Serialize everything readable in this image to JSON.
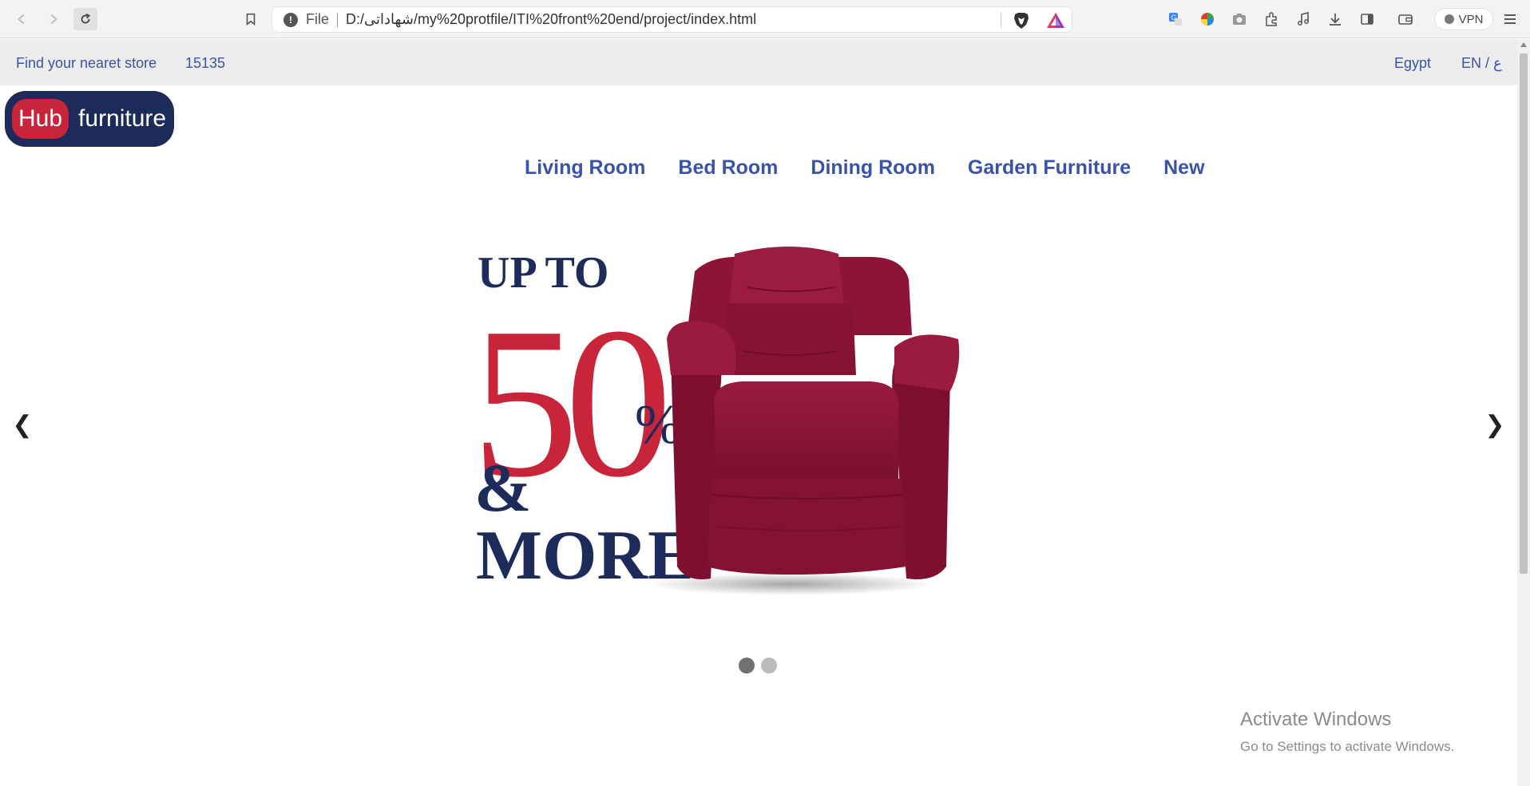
{
  "browser": {
    "address_prefix": "File",
    "url": "D:/شهاداتى/my%20protfile/ITI%20front%20end/project/index.html",
    "vpn_label": "VPN"
  },
  "topbar": {
    "store_label": "Find your nearet store",
    "hotline": "15135",
    "country": "Egypt",
    "language": "EN / ع"
  },
  "logo": {
    "hub": "Hub",
    "furniture": "furniture"
  },
  "nav": {
    "items": [
      "Living Room",
      "Bed Room",
      "Dining Room",
      "Garden Furniture",
      "New"
    ]
  },
  "carousel": {
    "prev": "❮",
    "next": "❯",
    "banner": {
      "line1": "UP TO",
      "number": "50",
      "percent": "%",
      "amp": "&",
      "line3": "MORE"
    },
    "slides": 2,
    "active_slide": 1
  },
  "watermark": {
    "title": "Activate Windows",
    "subtitle": "Go to Settings to activate Windows."
  },
  "colors": {
    "brand_navy": "#1c2b5a",
    "brand_red": "#c8243a",
    "nav_blue": "#3a53a6",
    "chair_maroon": "#8c1436"
  }
}
